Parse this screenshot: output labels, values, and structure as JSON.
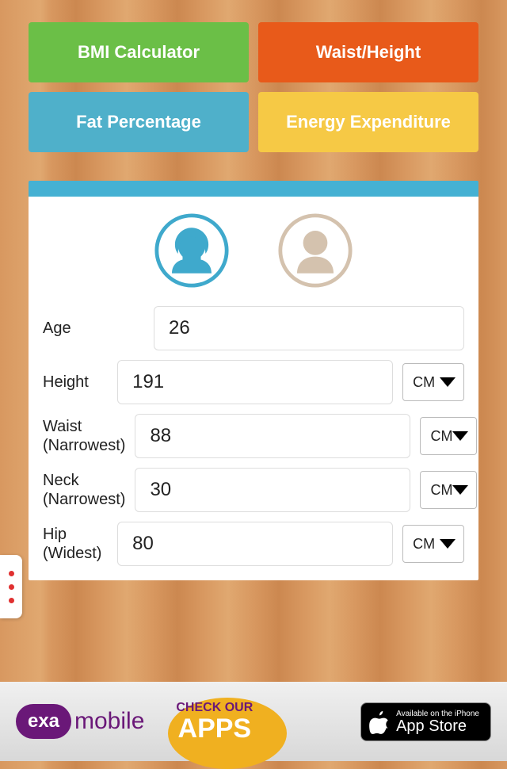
{
  "tabs": {
    "bmi": "BMI Calculator",
    "waist_height": "Waist/Height",
    "fat": "Fat Percentage",
    "energy": "Energy Expenditure"
  },
  "gender": {
    "selected": "female"
  },
  "form": {
    "age": {
      "label": "Age",
      "value": "26"
    },
    "height": {
      "label": "Height",
      "value": "191",
      "unit": "CM"
    },
    "waist": {
      "label": "Waist (Narrowest)",
      "value": "88",
      "unit": "CM"
    },
    "neck": {
      "label": "Neck (Narrowest)",
      "value": "30",
      "unit": "CM"
    },
    "hip": {
      "label": "Hip (Widest)",
      "value": "80",
      "unit": "CM"
    }
  },
  "footer": {
    "exa": "exa",
    "mobile": "mobile",
    "check": "CHECK OUR",
    "apps": "APPS",
    "appstore_small": "Available on the iPhone",
    "appstore_big": "App Store"
  }
}
